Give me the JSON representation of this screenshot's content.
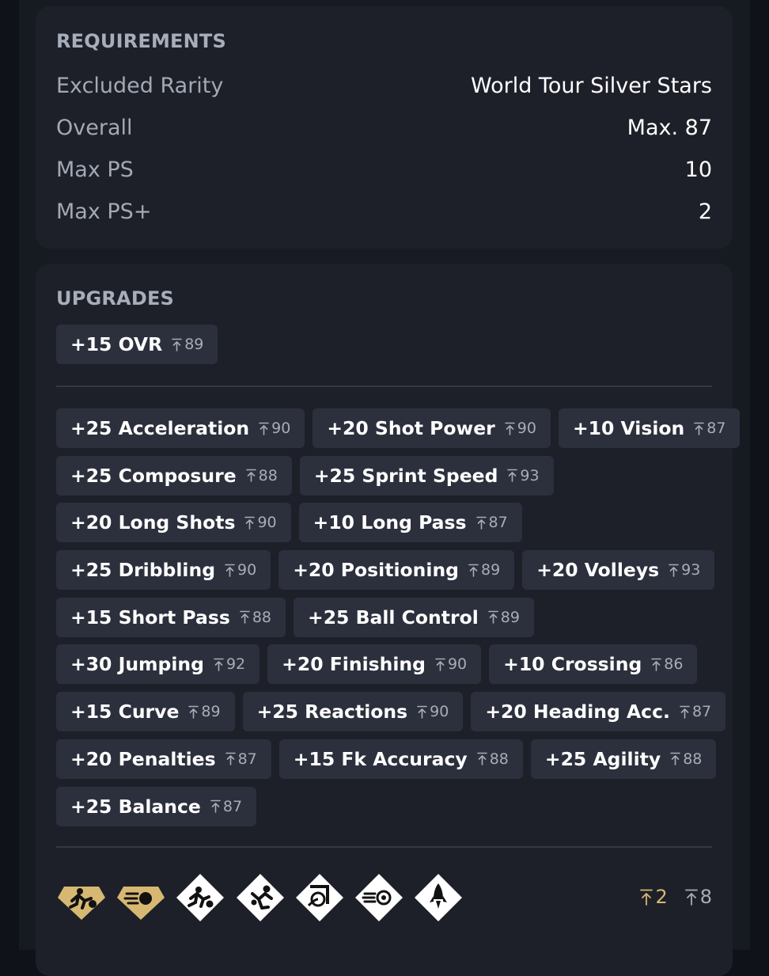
{
  "requirements": {
    "title": "REQUIREMENTS",
    "rows": [
      {
        "label": "Excluded Rarity",
        "value": "World Tour Silver Stars"
      },
      {
        "label": "Overall",
        "value": "Max. 87"
      },
      {
        "label": "Max PS",
        "value": "10"
      },
      {
        "label": "Max PS+",
        "value": "2"
      }
    ]
  },
  "upgrades": {
    "title": "UPGRADES",
    "ovr": {
      "label": "+15 OVR",
      "cap": "89"
    },
    "rows": [
      [
        {
          "label": "+25 Acceleration",
          "cap": "90"
        },
        {
          "label": "+20 Shot Power",
          "cap": "90"
        },
        {
          "label": "+10 Vision",
          "cap": "87"
        }
      ],
      [
        {
          "label": "+25 Composure",
          "cap": "88"
        },
        {
          "label": "+25 Sprint Speed",
          "cap": "93"
        }
      ],
      [
        {
          "label": "+20 Long Shots",
          "cap": "90"
        },
        {
          "label": "+10 Long Pass",
          "cap": "87"
        }
      ],
      [
        {
          "label": "+25 Dribbling",
          "cap": "90"
        },
        {
          "label": "+20 Positioning",
          "cap": "89"
        },
        {
          "label": "+20 Volleys",
          "cap": "93"
        }
      ],
      [
        {
          "label": "+15 Short Pass",
          "cap": "88"
        },
        {
          "label": "+25 Ball Control",
          "cap": "89"
        }
      ],
      [
        {
          "label": "+30 Jumping",
          "cap": "92"
        },
        {
          "label": "+20 Finishing",
          "cap": "90"
        },
        {
          "label": "+10 Crossing",
          "cap": "86"
        }
      ],
      [
        {
          "label": "+15 Curve",
          "cap": "89"
        },
        {
          "label": "+25 Reactions",
          "cap": "90"
        },
        {
          "label": "+20 Heading Acc.",
          "cap": "87"
        }
      ],
      [
        {
          "label": "+20 Penalties",
          "cap": "87"
        },
        {
          "label": "+15 Fk Accuracy",
          "cap": "88"
        },
        {
          "label": "+25 Agility",
          "cap": "88"
        }
      ],
      [
        {
          "label": "+25 Balance",
          "cap": "87"
        }
      ]
    ]
  },
  "playstyles": {
    "icons": [
      {
        "name": "quick-step-plus-icon",
        "tier": "plus"
      },
      {
        "name": "power-shot-plus-icon",
        "tier": "plus"
      },
      {
        "name": "quick-step-icon",
        "tier": "base"
      },
      {
        "name": "acrobatic-icon",
        "tier": "base"
      },
      {
        "name": "trivela-icon",
        "tier": "base"
      },
      {
        "name": "power-shot-icon",
        "tier": "base"
      },
      {
        "name": "rocket-icon",
        "tier": "base"
      }
    ],
    "plus_count": "2",
    "base_count": "8"
  },
  "colors": {
    "gold": "#d7b873",
    "chip_bg": "#2c303d",
    "card_bg": "#1d2029"
  }
}
